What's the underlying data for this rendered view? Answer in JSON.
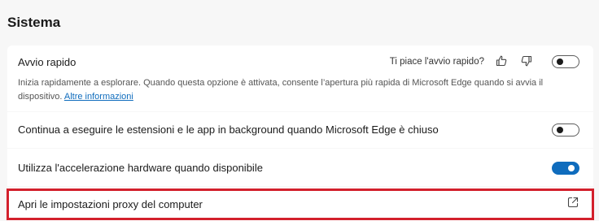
{
  "section": {
    "title": "Sistema"
  },
  "startup_boost": {
    "label": "Avvio rapido",
    "feedback_prompt": "Ti piace l'avvio rapido?",
    "like_icon": "thumbs-up-icon",
    "dislike_icon": "thumbs-down-icon",
    "toggle_state": "off",
    "description": "Inizia rapidamente a esplorare. Quando questa opzione è attivata, consente l’apertura più rapida di Microsoft Edge quando si avvia il dispositivo. ",
    "learn_more": "Altre informazioni"
  },
  "background_apps": {
    "label": "Continua a eseguire le estensioni e le app in background quando Microsoft Edge è chiuso",
    "toggle_state": "off"
  },
  "hardware_acceleration": {
    "label": "Utilizza l'accelerazione hardware quando disponibile",
    "toggle_state": "on"
  },
  "proxy_settings": {
    "label": "Apri le impostazioni proxy del computer",
    "icon": "external-link-icon"
  },
  "colors": {
    "accent": "#0f6cbd",
    "highlight_border": "#d3202c",
    "page_background": "#f7f7f7",
    "card_background": "#ffffff"
  }
}
